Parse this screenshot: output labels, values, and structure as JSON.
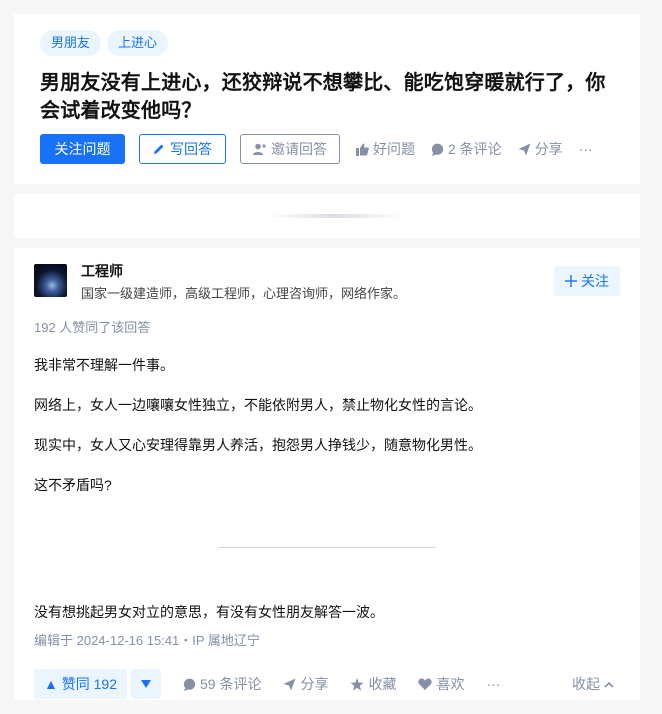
{
  "question": {
    "tags": [
      "男朋友",
      "上进心"
    ],
    "title": "男朋友没有上进心，还狡辩说不想攀比、能吃饱穿暖就行了，你会试着改变他吗？",
    "follow_label": "关注问题",
    "write_label": "写回答",
    "invite_label": "邀请回答",
    "good_label": "好问题",
    "comments_label": "2 条评论",
    "share_label": "分享",
    "more_label": "···"
  },
  "answer": {
    "author_name": "工程师",
    "author_bio": "国家一级建造师，高级工程师，心理咨询师，网络作家。",
    "follow_label": "关注",
    "votes_text": "192 人赞同了该回答",
    "paragraphs": [
      "我非常不理解一件事。",
      "网络上，女人一边嚷嚷女性独立，不能依附男人，禁止物化女性的言论。",
      "现实中，女人又心安理得靠男人养活，抱怨男人挣钱少，随意物化男性。",
      "这不矛盾吗?"
    ],
    "closing": "没有想挑起男女对立的意思，有没有女性朋友解答一波。",
    "edited": "编辑于 2024-12-16 15:41・IP 属地辽宁",
    "upvote_label": "▲ 赞同 192",
    "comments_label": "59 条评论",
    "share_label": "分享",
    "collect_label": "收藏",
    "like_label": "喜欢",
    "more_label": "···",
    "collapse_label": "收起"
  },
  "colors": {
    "accent": "#1772f6",
    "muted": "#8590a6",
    "accent_bg": "#ebf5ff"
  }
}
